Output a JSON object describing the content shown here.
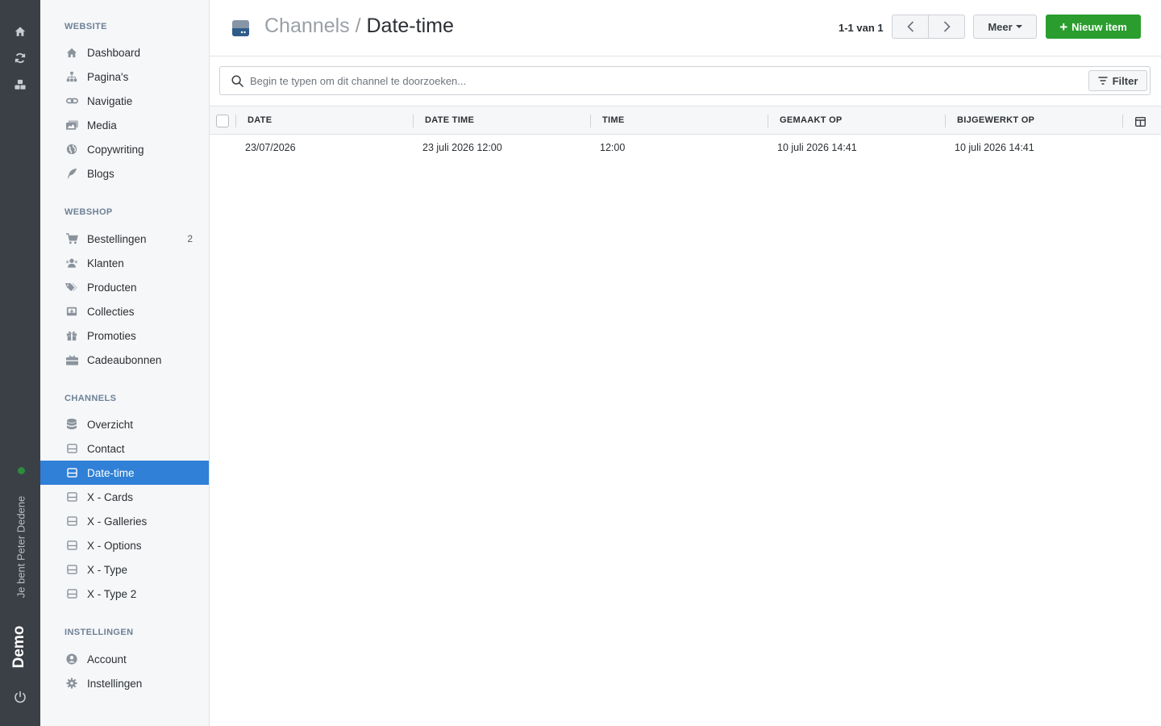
{
  "rail": {
    "user_label": "Je bent Peter Dedene",
    "site_label": "Demo"
  },
  "sidebar": {
    "sections": {
      "website": "WEBSITE",
      "webshop": "WEBSHOP",
      "channels": "CHANNELS",
      "instellingen": "INSTELLINGEN"
    },
    "website_items": [
      {
        "label": "Dashboard",
        "icon": "home-icon"
      },
      {
        "label": "Pagina's",
        "icon": "sitemap-icon"
      },
      {
        "label": "Navigatie",
        "icon": "link-icon"
      },
      {
        "label": "Media",
        "icon": "images-icon"
      },
      {
        "label": "Copywriting",
        "icon": "globe-icon"
      },
      {
        "label": "Blogs",
        "icon": "feather-icon"
      }
    ],
    "webshop_items": [
      {
        "label": "Bestellingen",
        "icon": "cart-icon",
        "badge": "2"
      },
      {
        "label": "Klanten",
        "icon": "users-icon"
      },
      {
        "label": "Producten",
        "icon": "tags-icon"
      },
      {
        "label": "Collecties",
        "icon": "inbox-icon"
      },
      {
        "label": "Promoties",
        "icon": "gift-icon"
      },
      {
        "label": "Cadeaubonnen",
        "icon": "gift-card-icon"
      }
    ],
    "channel_items": [
      {
        "label": "Overzicht",
        "icon": "database-icon"
      },
      {
        "label": "Contact",
        "icon": "channel-icon"
      },
      {
        "label": "Date-time",
        "icon": "channel-icon",
        "active": true
      },
      {
        "label": "X - Cards",
        "icon": "channel-icon"
      },
      {
        "label": "X - Galleries",
        "icon": "channel-icon"
      },
      {
        "label": "X - Options",
        "icon": "channel-icon"
      },
      {
        "label": "X - Type",
        "icon": "channel-icon"
      },
      {
        "label": "X - Type 2",
        "icon": "channel-icon"
      }
    ],
    "settings_items": [
      {
        "label": "Account",
        "icon": "user-circle-icon"
      },
      {
        "label": "Instellingen",
        "icon": "gear-icon"
      }
    ]
  },
  "header": {
    "breadcrumb_parent": "Channels",
    "breadcrumb_separator": "/",
    "breadcrumb_current": "Date-time",
    "page_count": "1-1 van 1",
    "more_label": "Meer",
    "new_item_label": "Nieuw item"
  },
  "search": {
    "placeholder": "Begin te typen om dit channel te doorzoeken...",
    "value": "",
    "filter_label": "Filter"
  },
  "table": {
    "columns": [
      "DATE",
      "DATE TIME",
      "TIME",
      "GEMAAKT OP",
      "BIJGEWERKT OP"
    ],
    "rows": [
      [
        "23/07/2026",
        "23 juli 2026 12:00",
        "12:00",
        "10 juli 2026 14:41",
        "10 juli 2026 14:41"
      ]
    ]
  },
  "colors": {
    "rail_bg": "#3b4046",
    "sidebar_bg": "#f6f7f9",
    "active_blue": "#2f80d6",
    "primary_green": "#2a9d2e",
    "section_title": "#6d8196",
    "status_green": "#2d8a3e"
  }
}
